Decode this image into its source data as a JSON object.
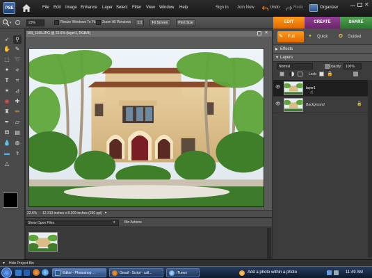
{
  "app": {
    "logo_text": "PSE"
  },
  "menu": [
    "File",
    "Edit",
    "Image",
    "Enhance",
    "Layer",
    "Select",
    "Filter",
    "View",
    "Window",
    "Help"
  ],
  "top_right": {
    "sign_in": "Sign In",
    "join_now": "Join Now",
    "undo": "Undo",
    "redo": "Redo",
    "organizer": "Organizer"
  },
  "options": {
    "zoom": "23%",
    "resize_windows": "Resize Windows To Fit",
    "zoom_all": "Zoom All Windows",
    "one_to_one": "1:1",
    "fit_screen": "Fit Screen",
    "print_size": "Print Size"
  },
  "mode_tabs": [
    "EDIT",
    "CREATE",
    "SHARE"
  ],
  "edit_tabs": [
    "Full",
    "Quick",
    "Guided"
  ],
  "document": {
    "title": "100_1165.JPG @ 22.6% (layer1, RGB/8)",
    "zoom": "22.6%",
    "info": "12.313 inches x 8.209 inches (230 ppi)"
  },
  "bin": {
    "dropdown": "Show Open Files",
    "actions": "Bin Actions",
    "hide": "Hide Project Bin"
  },
  "panels": {
    "effects": "Effects",
    "layers": "Layers"
  },
  "layers_panel": {
    "blend_mode": "Normal",
    "opacity_label": "Opacity:",
    "opacity": "100%",
    "lock_label": "Lock:",
    "layers": [
      {
        "name": "layer1",
        "selected": true
      },
      {
        "name": "Background",
        "selected": false
      }
    ]
  },
  "taskbar": {
    "items": [
      "Editor - Photoshop ...",
      "Gmail - Script - call...",
      "iTunes"
    ],
    "notification": "Add a photo within a photo",
    "time": "11:49 AM"
  },
  "colors": {
    "edit": "#f07c00",
    "create": "#7a2f7c",
    "share": "#3b8a3e",
    "accent": "#2b5797"
  }
}
